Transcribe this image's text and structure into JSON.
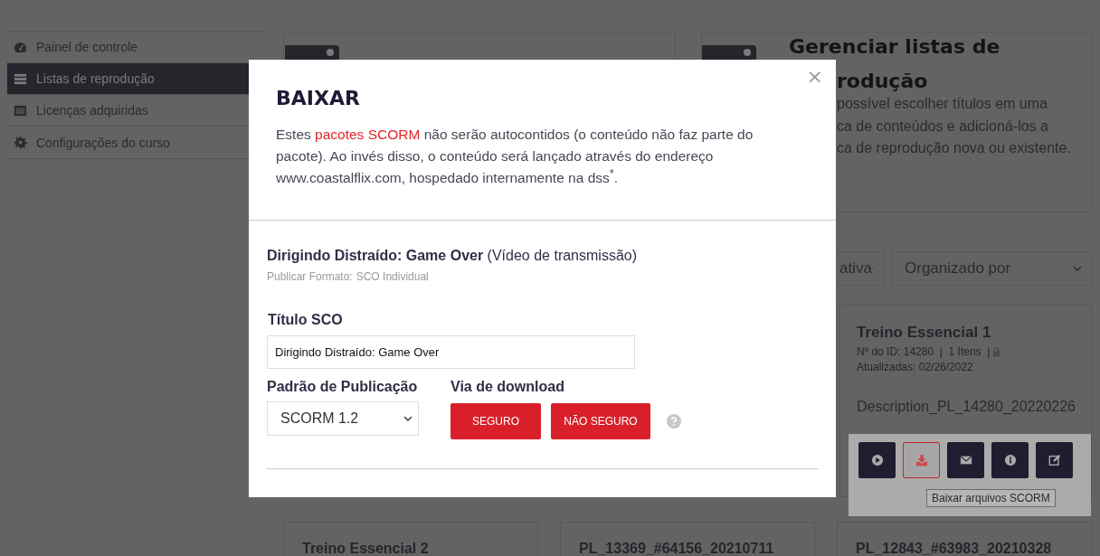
{
  "sidebar": {
    "items": [
      {
        "label": "Painel de controle",
        "selected": false
      },
      {
        "label": "Listas de reprodução",
        "selected": true
      },
      {
        "label": "Licenças adquiridas",
        "selected": false
      },
      {
        "label": "Configurações do curso",
        "selected": false
      }
    ]
  },
  "top_cards": [
    {
      "title_lines": [
        "Gerenciar listas de",
        "rodução"
      ],
      "text_lines": [
        "possível escolher títulos em uma",
        "ca de conteúdos e adicioná-los a",
        "ca de reprodução nova ou existente."
      ]
    }
  ],
  "filters": [
    "ativa",
    "Organizado por"
  ],
  "playlist_card": {
    "title": "Treino Essencial 1",
    "meta": "Nº do ID: 14280  |  1 Itens  |",
    "locked": true,
    "updated": "Atualizadas: 02/26/2022",
    "description": "Description_PL_14280_20220226",
    "actions": [
      {
        "hovered": false
      },
      {
        "hovered": true
      },
      {
        "hovered": false
      },
      {
        "hovered": false
      },
      {
        "hovered": false
      }
    ],
    "tooltip": "Baixar arquivos SCORM"
  },
  "bottom_cards": [
    "Treino Essencial 2",
    "PL_13369_#64156_20210711",
    "PL_12843_#63983_20210328"
  ],
  "modal": {
    "close": "×",
    "title": "BAIXAR",
    "description": {
      "before": "Estes ",
      "link": "pacotes SCORM",
      "after": " não serão autocontidos (o conteúdo não faz parte do pacote). Ao invés disso, o conteúdo será lançado através do endereço www.coastalflix.com, hospedado internamente na dss$^{*}$."
    },
    "item_title": "**Dirigindo Distraído: Game Over** (Vídeo de transmissão)",
    "format_label": "Publicar Formato:",
    "format_value": "SCO Individual",
    "sco_label": "Título SCO",
    "sco_value": "Dirigindo Distraído: Game Over",
    "standard_label": "Padrão de Publicação",
    "standard_value": "SCORM 1.2",
    "via_label": "Via de download",
    "buttons": [
      "SEGURO",
      "NÃO SEGURO"
    ]
  }
}
